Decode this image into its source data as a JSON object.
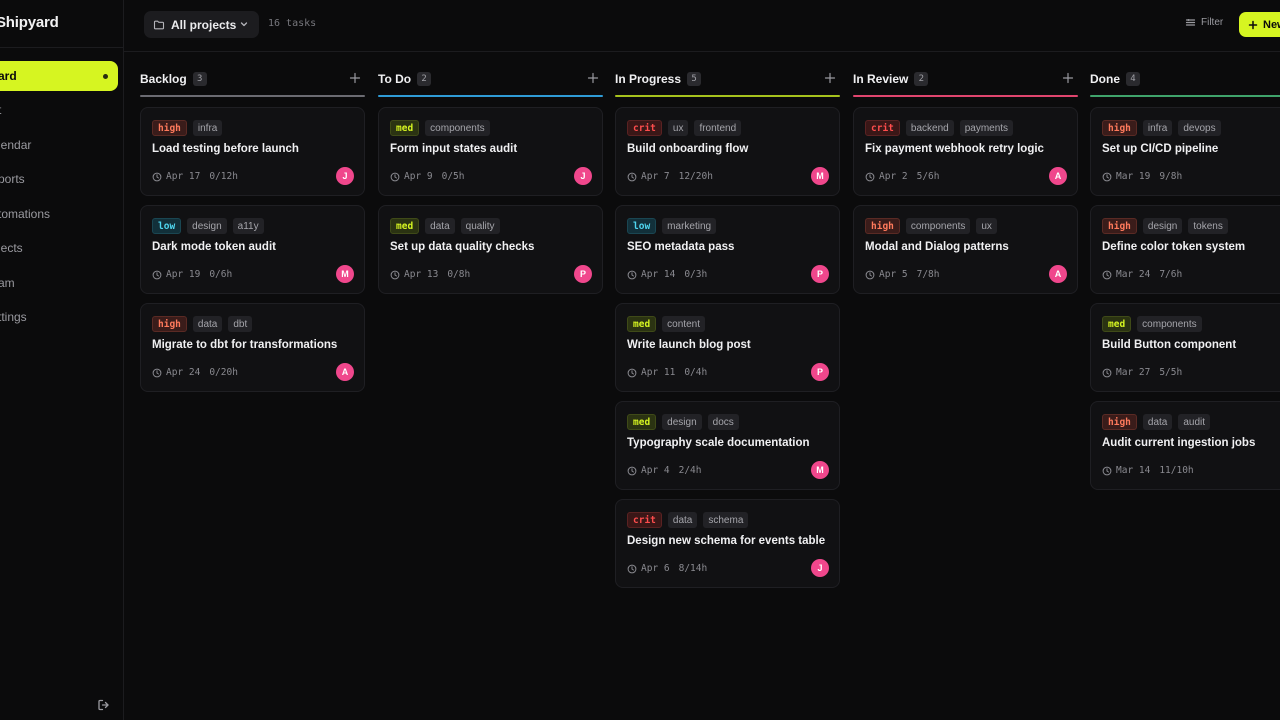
{
  "app": {
    "brand": "Shipyard"
  },
  "sidebar": {
    "items": [
      {
        "label": "ard",
        "active": true,
        "icon": "board-icon"
      },
      {
        "label": "t",
        "active": false,
        "icon": "list-icon"
      },
      {
        "label": "lendar",
        "active": false,
        "icon": "calendar-icon"
      },
      {
        "label": "ports",
        "active": false,
        "icon": "reports-icon"
      },
      {
        "label": "tomations",
        "active": false,
        "icon": "automations-icon"
      },
      {
        "label": "jects",
        "active": false,
        "icon": "projects-icon"
      },
      {
        "label": "am",
        "active": false,
        "icon": "team-icon"
      },
      {
        "label": "ttings",
        "active": false,
        "icon": "settings-icon"
      }
    ],
    "logout_icon": "logout-icon"
  },
  "topbar": {
    "project_select": "All projects",
    "task_count": "16 tasks",
    "filter_label": "Filter",
    "new_label": "New"
  },
  "colors": {
    "accent": "#d6f521",
    "avatar": "#f0478c",
    "backlog": "#6b6b72",
    "todo": "#2f9bd6",
    "in_progress": "#a6c21d",
    "in_review": "#e0456e",
    "done": "#3fa36b"
  },
  "columns": [
    {
      "title": "Backlog",
      "count": "3",
      "color_key": "backlog",
      "cards": [
        {
          "priority": "high",
          "tags": [
            "infra"
          ],
          "title": "Load testing before launch",
          "date": "Apr 17",
          "est": "0/12h",
          "assignee": "J"
        },
        {
          "priority": "low",
          "tags": [
            "design",
            "a11y"
          ],
          "title": "Dark mode token audit",
          "date": "Apr 19",
          "est": "0/6h",
          "assignee": "M"
        },
        {
          "priority": "high",
          "tags": [
            "data",
            "dbt"
          ],
          "title": "Migrate to dbt for transformations",
          "date": "Apr 24",
          "est": "0/20h",
          "assignee": "A"
        }
      ]
    },
    {
      "title": "To Do",
      "count": "2",
      "color_key": "todo",
      "cards": [
        {
          "priority": "med",
          "tags": [
            "components"
          ],
          "title": "Form input states audit",
          "date": "Apr 9",
          "est": "0/5h",
          "assignee": "J"
        },
        {
          "priority": "med",
          "tags": [
            "data",
            "quality"
          ],
          "title": "Set up data quality checks",
          "date": "Apr 13",
          "est": "0/8h",
          "assignee": "P"
        }
      ]
    },
    {
      "title": "In Progress",
      "count": "5",
      "color_key": "in_progress",
      "cards": [
        {
          "priority": "crit",
          "tags": [
            "ux",
            "frontend"
          ],
          "title": "Build onboarding flow",
          "date": "Apr 7",
          "est": "12/20h",
          "assignee": "M"
        },
        {
          "priority": "low",
          "tags": [
            "marketing"
          ],
          "title": "SEO metadata pass",
          "date": "Apr 14",
          "est": "0/3h",
          "assignee": "P"
        },
        {
          "priority": "med",
          "tags": [
            "content"
          ],
          "title": "Write launch blog post",
          "date": "Apr 11",
          "est": "0/4h",
          "assignee": "P"
        },
        {
          "priority": "med",
          "tags": [
            "design",
            "docs"
          ],
          "title": "Typography scale documentation",
          "date": "Apr 4",
          "est": "2/4h",
          "assignee": "M"
        },
        {
          "priority": "crit",
          "tags": [
            "data",
            "schema"
          ],
          "title": "Design new schema for events table",
          "date": "Apr 6",
          "est": "8/14h",
          "assignee": "J"
        }
      ]
    },
    {
      "title": "In Review",
      "count": "2",
      "color_key": "in_review",
      "cards": [
        {
          "priority": "crit",
          "tags": [
            "backend",
            "payments"
          ],
          "title": "Fix payment webhook retry logic",
          "date": "Apr 2",
          "est": "5/6h",
          "assignee": "A"
        },
        {
          "priority": "high",
          "tags": [
            "components",
            "ux"
          ],
          "title": "Modal and Dialog patterns",
          "date": "Apr 5",
          "est": "7/8h",
          "assignee": "A"
        }
      ]
    },
    {
      "title": "Done",
      "count": "4",
      "color_key": "done",
      "cards": [
        {
          "priority": "high",
          "tags": [
            "infra",
            "devops"
          ],
          "title": "Set up CI/CD pipeline",
          "date": "Mar 19",
          "est": "9/8h",
          "assignee": ""
        },
        {
          "priority": "high",
          "tags": [
            "design",
            "tokens"
          ],
          "title": "Define color token system",
          "date": "Mar 24",
          "est": "7/6h",
          "assignee": ""
        },
        {
          "priority": "med",
          "tags": [
            "components"
          ],
          "title": "Build Button component",
          "date": "Mar 27",
          "est": "5/5h",
          "assignee": ""
        },
        {
          "priority": "high",
          "tags": [
            "data",
            "audit"
          ],
          "title": "Audit current ingestion jobs",
          "date": "Mar 14",
          "est": "11/10h",
          "assignee": ""
        }
      ]
    }
  ]
}
